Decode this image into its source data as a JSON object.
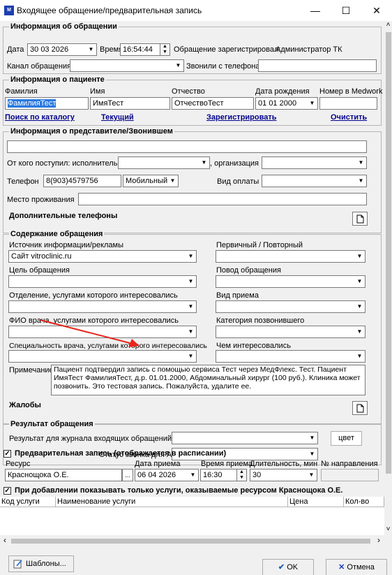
{
  "window": {
    "title": "Входящее обращение/предварительная запись",
    "app_icon": "М",
    "min": "—",
    "max": "☐",
    "close": "✕"
  },
  "info": {
    "title": "Информация об обращении",
    "date_label": "Дата",
    "day": "30",
    "month": "03",
    "year": "2026",
    "time_label": "Время",
    "time": "16:54:44",
    "registered_label": "Обращение зарегистрировал:",
    "registered_by": "Администратор ТК",
    "channel_label": "Канал обращения",
    "channel_value": "",
    "phone_label": "Звонили с телефона",
    "phone_value": ""
  },
  "patient": {
    "title": "Информация о пациенте",
    "lastname_label": "Фамилия",
    "lastname": "ФамилияТест",
    "firstname_label": "Имя",
    "firstname": "ИмяТест",
    "patronymic_label": "Отчество",
    "patronymic": "ОтчествоТест",
    "dob_label": "Дата рождения",
    "dob_day": "01",
    "dob_month": "01",
    "dob_year": "2000",
    "medwork_label": "Номер в Medwork",
    "medwork": "",
    "link_search": "Поиск по каталогу",
    "link_current": "Текущий",
    "link_register": "Зарегистрировать",
    "link_clear": "Очистить"
  },
  "rep": {
    "title": "Информация о представителе/Звонившем",
    "name": "",
    "from_label": "От кого поступил: исполнитель",
    "org_label": ", организация",
    "phone_label": "Телефон",
    "phone": "8(903)4579756",
    "phone_type": "Мобильный",
    "payment_label": "Вид оплаты",
    "address_label": "Место проживания",
    "extra_phones": "Дополнительные телефоны"
  },
  "content": {
    "title": "Содержание обращения",
    "source_label": "Источник информации/рекламы",
    "source_value": "Сайт vitroclinic.ru",
    "primary_label": "Первичный / Повторный",
    "goal_label": "Цель обращения",
    "reason_label": "Повод обращения",
    "dept_label": "Отделение, услугами которого интересовались",
    "visit_type_label": "Вид приема",
    "doctor_label": "ФИО врача, услугами которого интересовались",
    "caller_cat_label": "Категория позвонившего",
    "spec_label": "Специальность врача, услугами которого интересовались",
    "interest_label": "Чем интересовались",
    "note_label": "Примечание",
    "note": "Пациент подтвердил запись с помощью сервиса Тест через МедФлекс. Тест. Пациент ИмяТест ФамилияТест, д.р. 01.01.2000, Абдоминальный хирург (100 руб.). Клиника может позвонить. Это тестовая запись. Пожалуйста, удалите ее.",
    "complaints": "Жалобы"
  },
  "result": {
    "title": "Результат обращения",
    "journal_label": "Результат для журнала входящих обращений",
    "color_btn": "цвет",
    "asterisk_label": "Статус звонка для Asterisk"
  },
  "prebook": {
    "check": "✓",
    "title": "Предварительная запись (отображается в расписании)",
    "resource_label": "Ресурс",
    "resource": "Краснощока О.Е.",
    "date_label": "Дата приема",
    "day": "06",
    "month": "04",
    "year": "2026",
    "time_label": "Время приема",
    "time": "16:30",
    "duration_label": "Длительность, мин",
    "duration": "30",
    "referral_label": "№ направления",
    "ellipsis": "...",
    "only_title": "При добавлении показывать только услуги, оказываемые ресурсом Краснощока О.Е.",
    "columns": [
      "Код услуги",
      "Наименование услуги",
      "Цена",
      "Кол-во"
    ]
  },
  "footer": {
    "templates": "Шаблоны...",
    "ok": "OK",
    "ok_icon": "✔",
    "cancel": "Отмена",
    "cancel_icon": "✕"
  },
  "scroll": {
    "up": "˄",
    "down": "˅",
    "left": "‹",
    "right": "›"
  },
  "colors": {
    "link": "#00008b",
    "highlight": "#2979e0",
    "arrow": "#e8261c"
  }
}
